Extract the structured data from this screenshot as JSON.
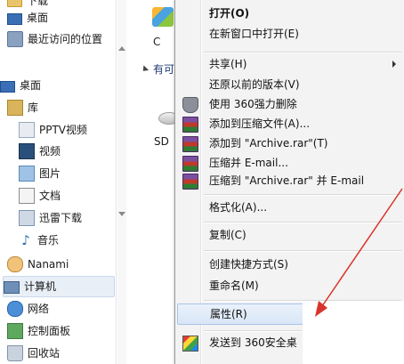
{
  "nav": {
    "items": [
      {
        "label": "下载",
        "icon": "folder-icon"
      },
      {
        "label": "桌面",
        "icon": "desktop-icon"
      },
      {
        "label": "最近访问的位置",
        "icon": "recent-places-icon"
      },
      {
        "label": "桌面",
        "icon": "desktop-icon"
      },
      {
        "label": "库",
        "icon": "library-icon"
      },
      {
        "label": "PPTV视频",
        "icon": "pptv-icon"
      },
      {
        "label": "视频",
        "icon": "video-icon"
      },
      {
        "label": "图片",
        "icon": "pictures-icon"
      },
      {
        "label": "文档",
        "icon": "documents-icon"
      },
      {
        "label": "迅雷下载",
        "icon": "xunlei-download-icon"
      },
      {
        "label": "音乐",
        "icon": "music-icon"
      },
      {
        "label": "Nanami",
        "icon": "user-folder-icon"
      },
      {
        "label": "计算机",
        "icon": "computer-icon"
      },
      {
        "label": "网络",
        "icon": "network-icon"
      },
      {
        "label": "控制面板",
        "icon": "control-panel-icon"
      },
      {
        "label": "回收站",
        "icon": "recycle-bin-icon"
      }
    ]
  },
  "content": {
    "drive_label": "C",
    "group_header": "有可",
    "sd_label": "SD"
  },
  "menu": {
    "items": [
      {
        "label": "打开(O)",
        "bold": true
      },
      {
        "label": "在新窗口中打开(E)"
      },
      {
        "label": "共享(H)",
        "submenu": true
      },
      {
        "label": "还原以前的版本(V)"
      },
      {
        "label": "使用 360强力删除",
        "icon": "shield-icon"
      },
      {
        "label": "添加到压缩文件(A)...",
        "icon": "winrar-icon"
      },
      {
        "label": "添加到 \"Archive.rar\"(T)",
        "icon": "winrar-icon"
      },
      {
        "label": "压缩并 E-mail...",
        "icon": "winrar-icon"
      },
      {
        "label": "压缩到 \"Archive.rar\" 并 E-mail",
        "icon": "winrar-icon"
      },
      {
        "label": "格式化(A)..."
      },
      {
        "label": "复制(C)"
      },
      {
        "label": "创建快捷方式(S)"
      },
      {
        "label": "重命名(M)"
      },
      {
        "label": "属性(R)",
        "highlighted": true
      },
      {
        "label": "发送到 360安全桌",
        "icon": "360-icon"
      }
    ]
  },
  "colors": {
    "annotation_arrow": "#d9342b",
    "highlight": "#d9e6f7",
    "menu_background": "#f3f3f3"
  }
}
